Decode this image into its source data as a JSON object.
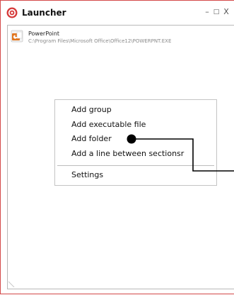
{
  "window": {
    "title": "Launcher",
    "minimize_glyph": "–",
    "maximize_glyph": "□",
    "close_glyph": "X",
    "accent_color": "#d44a4a"
  },
  "items": [
    {
      "name": "PowerPoint",
      "path": "C:\\Program Files\\Microsoft Office\\Office12\\POWERPNT.EXE",
      "icon": "powerpoint-icon"
    }
  ],
  "context_menu": {
    "items": [
      "Add group",
      "Add executable file",
      "Add folder",
      "Add a line between sectionsr",
      "Settings"
    ]
  },
  "icons": {
    "app": "launcher-target-icon",
    "item": "powerpoint-icon"
  }
}
